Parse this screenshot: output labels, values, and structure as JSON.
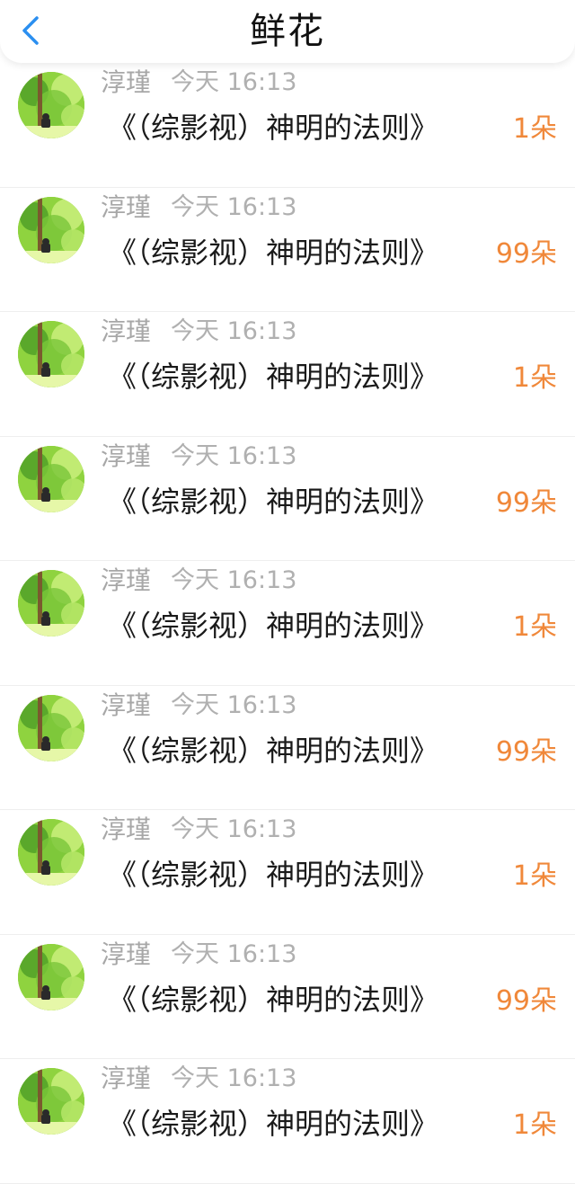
{
  "header": {
    "title": "鲜花",
    "back_icon": "chevron-left-icon",
    "accent_color": "#2b8ff0"
  },
  "items": [
    {
      "name": "淳瑾",
      "time": "今天 16:13",
      "book": "《（综影视）神明的法则》",
      "count": "1朵"
    },
    {
      "name": "淳瑾",
      "time": "今天 16:13",
      "book": "《（综影视）神明的法则》",
      "count": "99朵"
    },
    {
      "name": "淳瑾",
      "time": "今天 16:13",
      "book": "《（综影视）神明的法则》",
      "count": "1朵"
    },
    {
      "name": "淳瑾",
      "time": "今天 16:13",
      "book": "《（综影视）神明的法则》",
      "count": "99朵"
    },
    {
      "name": "淳瑾",
      "time": "今天 16:13",
      "book": "《（综影视）神明的法则》",
      "count": "1朵"
    },
    {
      "name": "淳瑾",
      "time": "今天 16:13",
      "book": "《（综影视）神明的法则》",
      "count": "99朵"
    },
    {
      "name": "淳瑾",
      "time": "今天 16:13",
      "book": "《（综影视）神明的法则》",
      "count": "1朵"
    },
    {
      "name": "淳瑾",
      "time": "今天 16:13",
      "book": "《（综影视）神明的法则》",
      "count": "99朵"
    },
    {
      "name": "淳瑾",
      "time": "今天 16:13",
      "book": "《（综影视）神明的法则》",
      "count": "1朵"
    }
  ],
  "colors": {
    "count": "#f0883a",
    "meta_text": "#a7a7a7"
  }
}
